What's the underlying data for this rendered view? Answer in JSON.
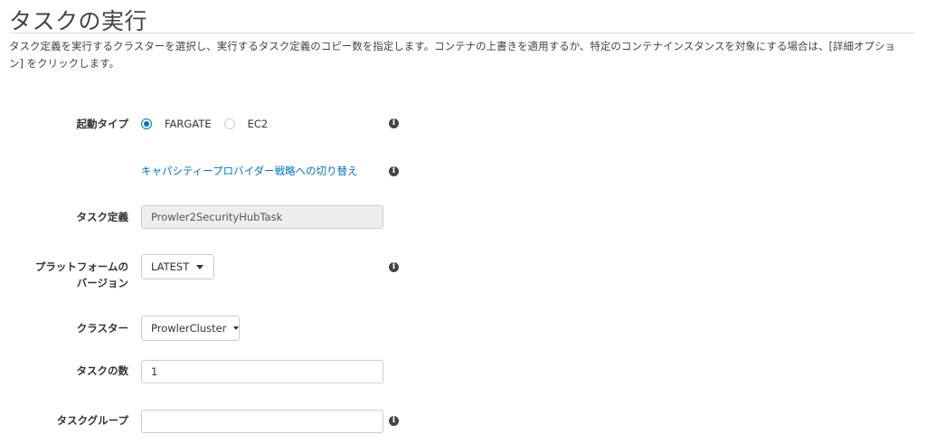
{
  "page": {
    "title": "タスクの実行",
    "description": "タスク定義を実行するクラスターを選択し、実行するタスク定義のコピー数を指定します。コンテナの上書きを適用するか、特定のコンテナインスタンスを対象にする場合は、[詳細オプション] をクリックします。"
  },
  "launch_type": {
    "label": "起動タイプ",
    "options": [
      {
        "label": "FARGATE",
        "selected": true
      },
      {
        "label": "EC2",
        "selected": false
      }
    ]
  },
  "capacity_link": {
    "label": "キャパシティープロバイダー戦略への切り替え"
  },
  "task_definition": {
    "label": "タスク定義",
    "value": "Prowler2SecurityHubTask"
  },
  "platform_version": {
    "label_line1": "プラットフォームの",
    "label_line2": "バージョン",
    "value": "LATEST"
  },
  "cluster": {
    "label": "クラスター",
    "value": "ProwlerCluster"
  },
  "task_count": {
    "label": "タスクの数",
    "value": "1"
  },
  "task_group": {
    "label": "タスクグループ",
    "value": ""
  },
  "icons": {
    "info": "info-icon",
    "dropdown": "caret-down-icon"
  },
  "colors": {
    "link": "#0073bb",
    "radio_selected": "#0073bb",
    "disabled_field": "#eeeeee"
  }
}
